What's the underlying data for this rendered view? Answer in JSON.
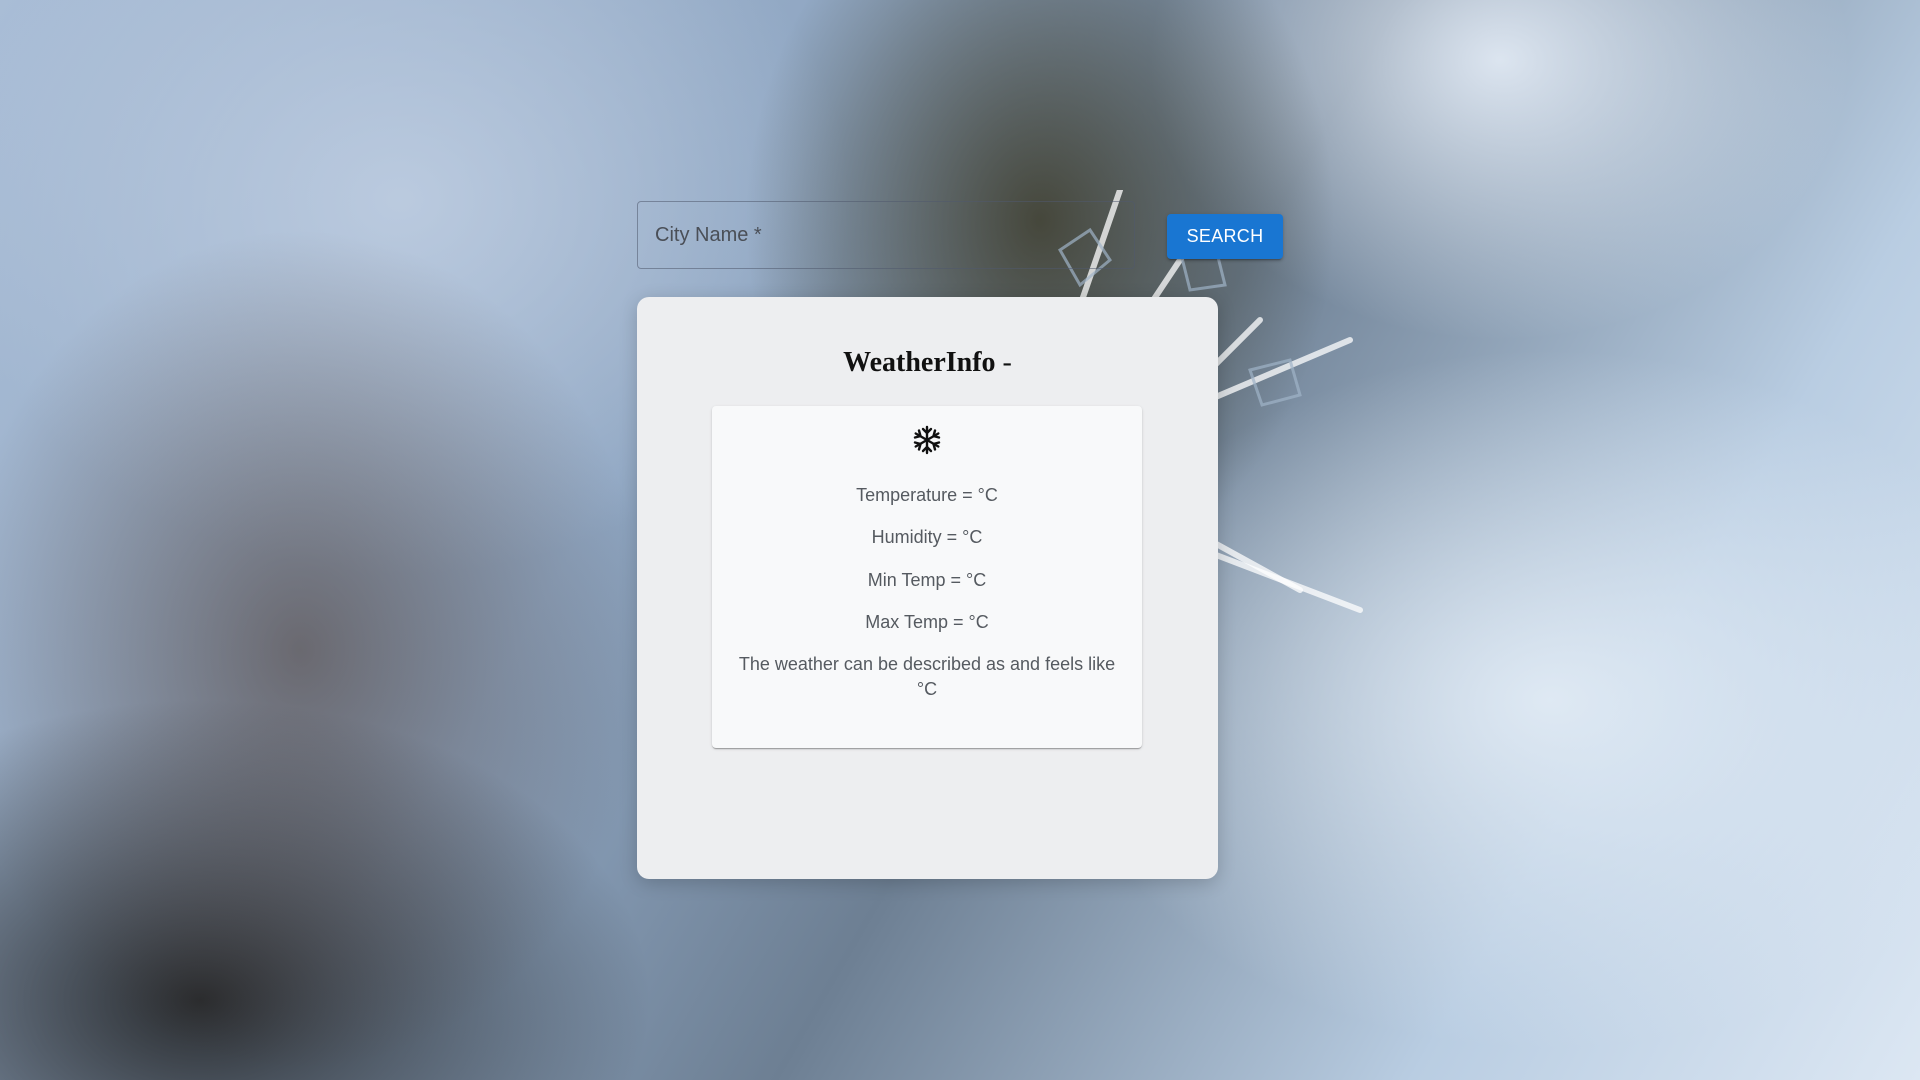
{
  "search": {
    "label": "City Name *",
    "value": "",
    "button_label": "SEARCH"
  },
  "card": {
    "title": "WeatherInfo",
    "title_separator": "-",
    "city": "",
    "icon": "snowflake-icon",
    "temperature": "Temperature = °C",
    "humidity": "Humidity = °C",
    "min_temp": "Min Temp = °C",
    "max_temp": "Max Temp = °C",
    "description": "The weather can be described as and feels like °C"
  },
  "colors": {
    "accent": "#1976d2",
    "card_background": "#edeef0",
    "inner_card_background": "#f8f9fa"
  }
}
